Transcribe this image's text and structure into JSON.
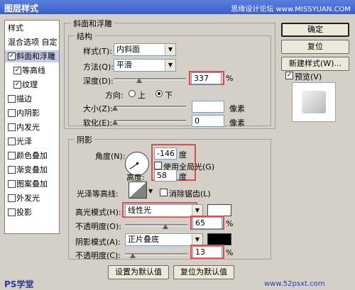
{
  "window": {
    "title": "图层样式",
    "watermark": "思缘设计论坛 www.MISSYUAN.COM"
  },
  "left_panel": {
    "items": [
      {
        "label": "样式",
        "type": "header"
      },
      {
        "label": "混合选项 自定",
        "type": "header"
      },
      {
        "label": "斜面和浮雕",
        "checked": true,
        "selected": true
      },
      {
        "label": "等高线",
        "checked": true,
        "sub": true
      },
      {
        "label": "纹理",
        "checked": true,
        "sub": true
      },
      {
        "label": "描边",
        "checked": false
      },
      {
        "label": "内阴影",
        "checked": false
      },
      {
        "label": "内发光",
        "checked": false
      },
      {
        "label": "光泽",
        "checked": false
      },
      {
        "label": "颜色叠加",
        "checked": false
      },
      {
        "label": "渐变叠加",
        "checked": false
      },
      {
        "label": "图案叠加",
        "checked": false
      },
      {
        "label": "外发光",
        "checked": false
      },
      {
        "label": "投影",
        "checked": false
      }
    ]
  },
  "bevel": {
    "group_title": "斜面和浮雕",
    "structure_title": "结构",
    "style_label": "样式(T):",
    "style_value": "内斜面",
    "method_label": "方法(Q):",
    "method_value": "平滑",
    "depth_label": "深度(D):",
    "depth_value": "337",
    "depth_unit": "%",
    "depth_level": 0.35,
    "direction_label": "方向:",
    "dir_up": "上",
    "dir_down": "下",
    "size_label": "大小(Z):",
    "size_value": "",
    "size_unit": "像素",
    "size_level": 0.02,
    "soften_label": "软化(E):",
    "soften_value": "0",
    "soften_unit": "像素",
    "soften_level": 0.02
  },
  "shading": {
    "group_title": "阴影",
    "angle_label": "角度(N):",
    "angle_value": "-146",
    "angle_unit": "度",
    "global_light_label": "使用全局光(G)",
    "altitude_label": "高度:",
    "altitude_value": "58",
    "altitude_unit": "度",
    "gloss_label": "光泽等高线:",
    "antialias_label": "消除锯齿(L)",
    "highlight_mode_label": "高光模式(H):",
    "highlight_mode_value": "线性光",
    "highlight_color": "#ffffff",
    "highlight_opacity_label": "不透明度(O):",
    "highlight_opacity_value": "65",
    "highlight_opacity_level": 0.65,
    "shadow_mode_label": "阴影模式(A):",
    "shadow_mode_value": "正片叠底",
    "shadow_color": "#000000",
    "shadow_opacity_label": "不透明度(C):",
    "shadow_opacity_value": "13",
    "shadow_opacity_level": 0.13,
    "percent": "%"
  },
  "footer": {
    "set_default": "设置为默认值",
    "reset_default": "复位为默认值"
  },
  "right_buttons": {
    "ok": "确定",
    "reset": "复位",
    "new_style": "新建样式(W)...",
    "preview_label": "预览(V)"
  },
  "branding": {
    "left": "PS学堂",
    "right": "www.52psxt.com"
  },
  "colors": {
    "highlight_box": "#e24c4c",
    "title_bar": "#3a5fcd"
  }
}
